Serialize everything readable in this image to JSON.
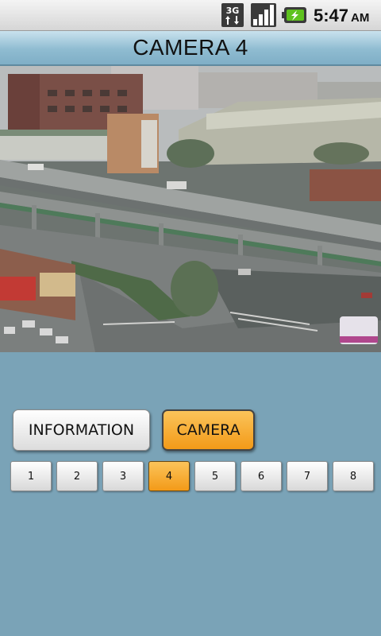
{
  "status_bar": {
    "network_label": "3G",
    "network_icon": "3g-data-icon",
    "signal_icon": "signal-strength-icon",
    "battery_icon": "battery-charging-icon",
    "time": "5:47",
    "ampm": "AM"
  },
  "header": {
    "title": "CAMERA 4"
  },
  "camera_view": {
    "image": "traffic-camera-feed"
  },
  "mode_buttons": {
    "information_label": "INFORMATION",
    "camera_label": "CAMERA",
    "selected": "CAMERA"
  },
  "camera_selector": {
    "buttons": [
      "1",
      "2",
      "3",
      "4",
      "5",
      "6",
      "7",
      "8"
    ],
    "selected": "4"
  },
  "colors": {
    "background": "#7aa3b7",
    "accent": "#f39a18",
    "title_bar": "#8fbcd1"
  }
}
